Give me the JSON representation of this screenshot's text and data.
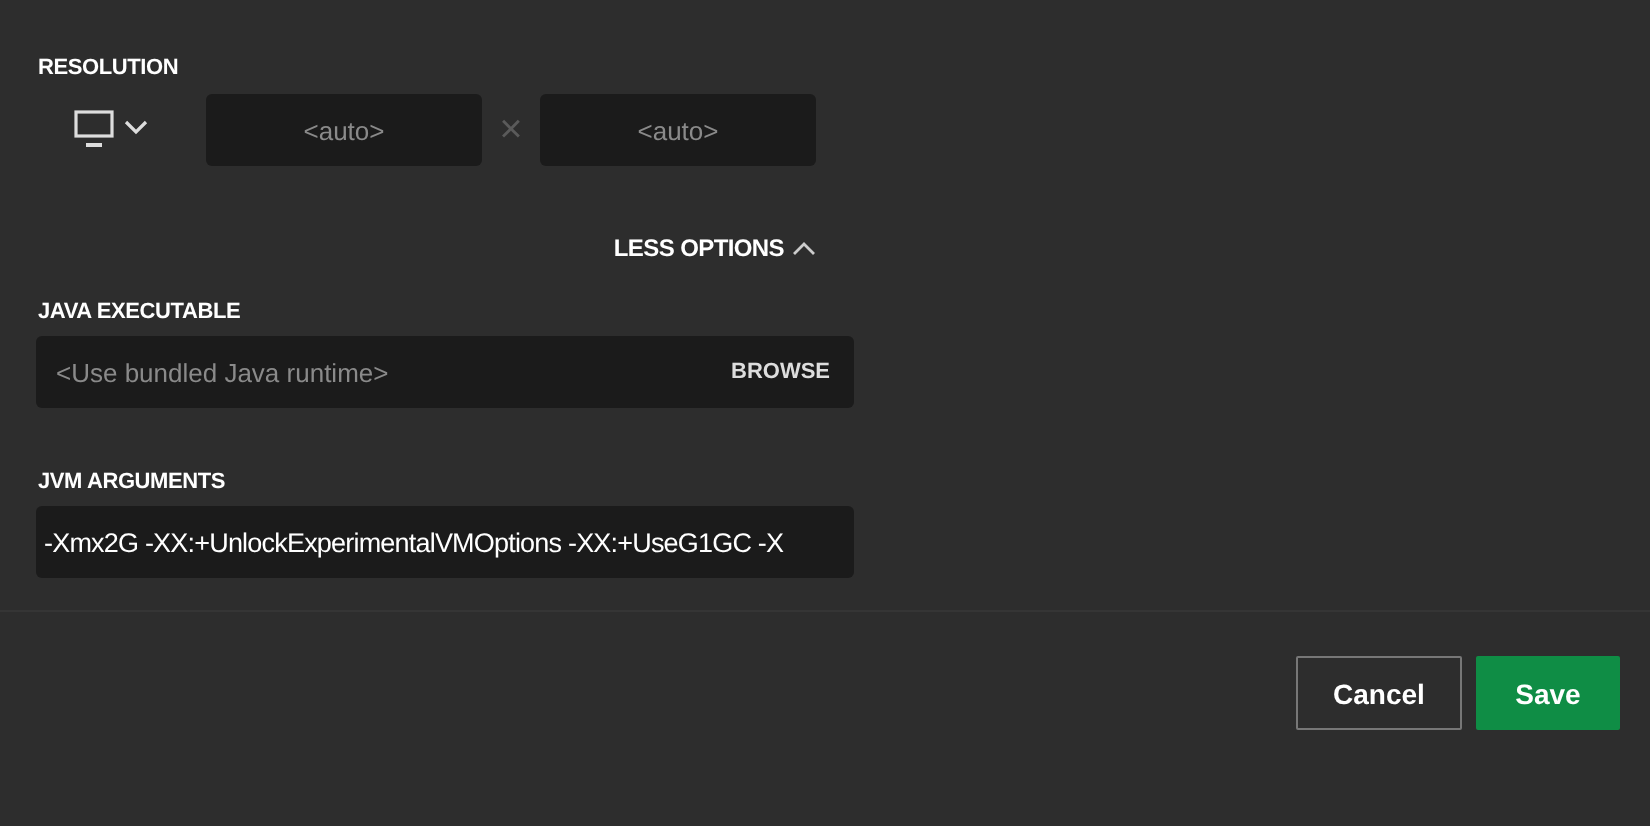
{
  "resolution": {
    "label": "RESOLUTION",
    "width": {
      "placeholder": "<auto>"
    },
    "separator": "×",
    "height": {
      "placeholder": "<auto>"
    }
  },
  "options_toggle": {
    "label": "LESS OPTIONS",
    "expanded": true
  },
  "java_executable": {
    "label": "JAVA EXECUTABLE",
    "placeholder": "<Use bundled Java runtime>",
    "action": "BROWSE"
  },
  "jvm_arguments": {
    "label": "JVM ARGUMENTS",
    "value": "-Xmx2G -XX:+UnlockExperimentalVMOptions -XX:+UseG1GC -X"
  },
  "buttons": [
    {
      "label": "Cancel",
      "kind": "secondary"
    },
    {
      "label": "Save",
      "kind": "primary"
    }
  ]
}
